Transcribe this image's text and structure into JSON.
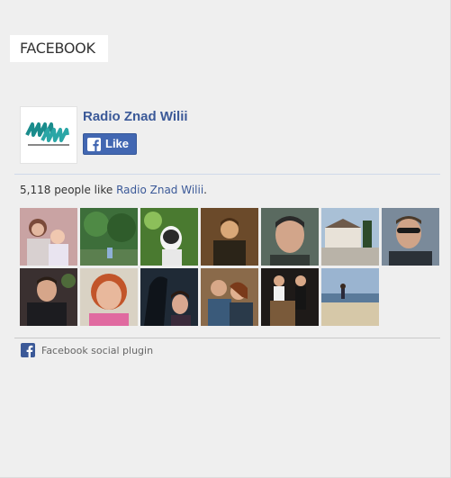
{
  "widget": {
    "heading": "FACEBOOK",
    "page_name": "Radio Znad Wilii",
    "like_label": "Like",
    "likes_count": "5,118",
    "likes_text": "people like",
    "likes_suffix": ".",
    "plugin_label": "Facebook social plugin"
  },
  "colors": {
    "brand": "#3b5998",
    "like_button": "#4267b2",
    "background": "#efefef"
  },
  "faces": [
    {
      "name": "fan-photo-1"
    },
    {
      "name": "fan-photo-2"
    },
    {
      "name": "fan-photo-3"
    },
    {
      "name": "fan-photo-4"
    },
    {
      "name": "fan-photo-5"
    },
    {
      "name": "fan-photo-6"
    },
    {
      "name": "fan-photo-7"
    },
    {
      "name": "fan-photo-8"
    },
    {
      "name": "fan-photo-9"
    },
    {
      "name": "fan-photo-10"
    },
    {
      "name": "fan-photo-11"
    },
    {
      "name": "fan-photo-12"
    },
    {
      "name": "fan-photo-13"
    }
  ]
}
